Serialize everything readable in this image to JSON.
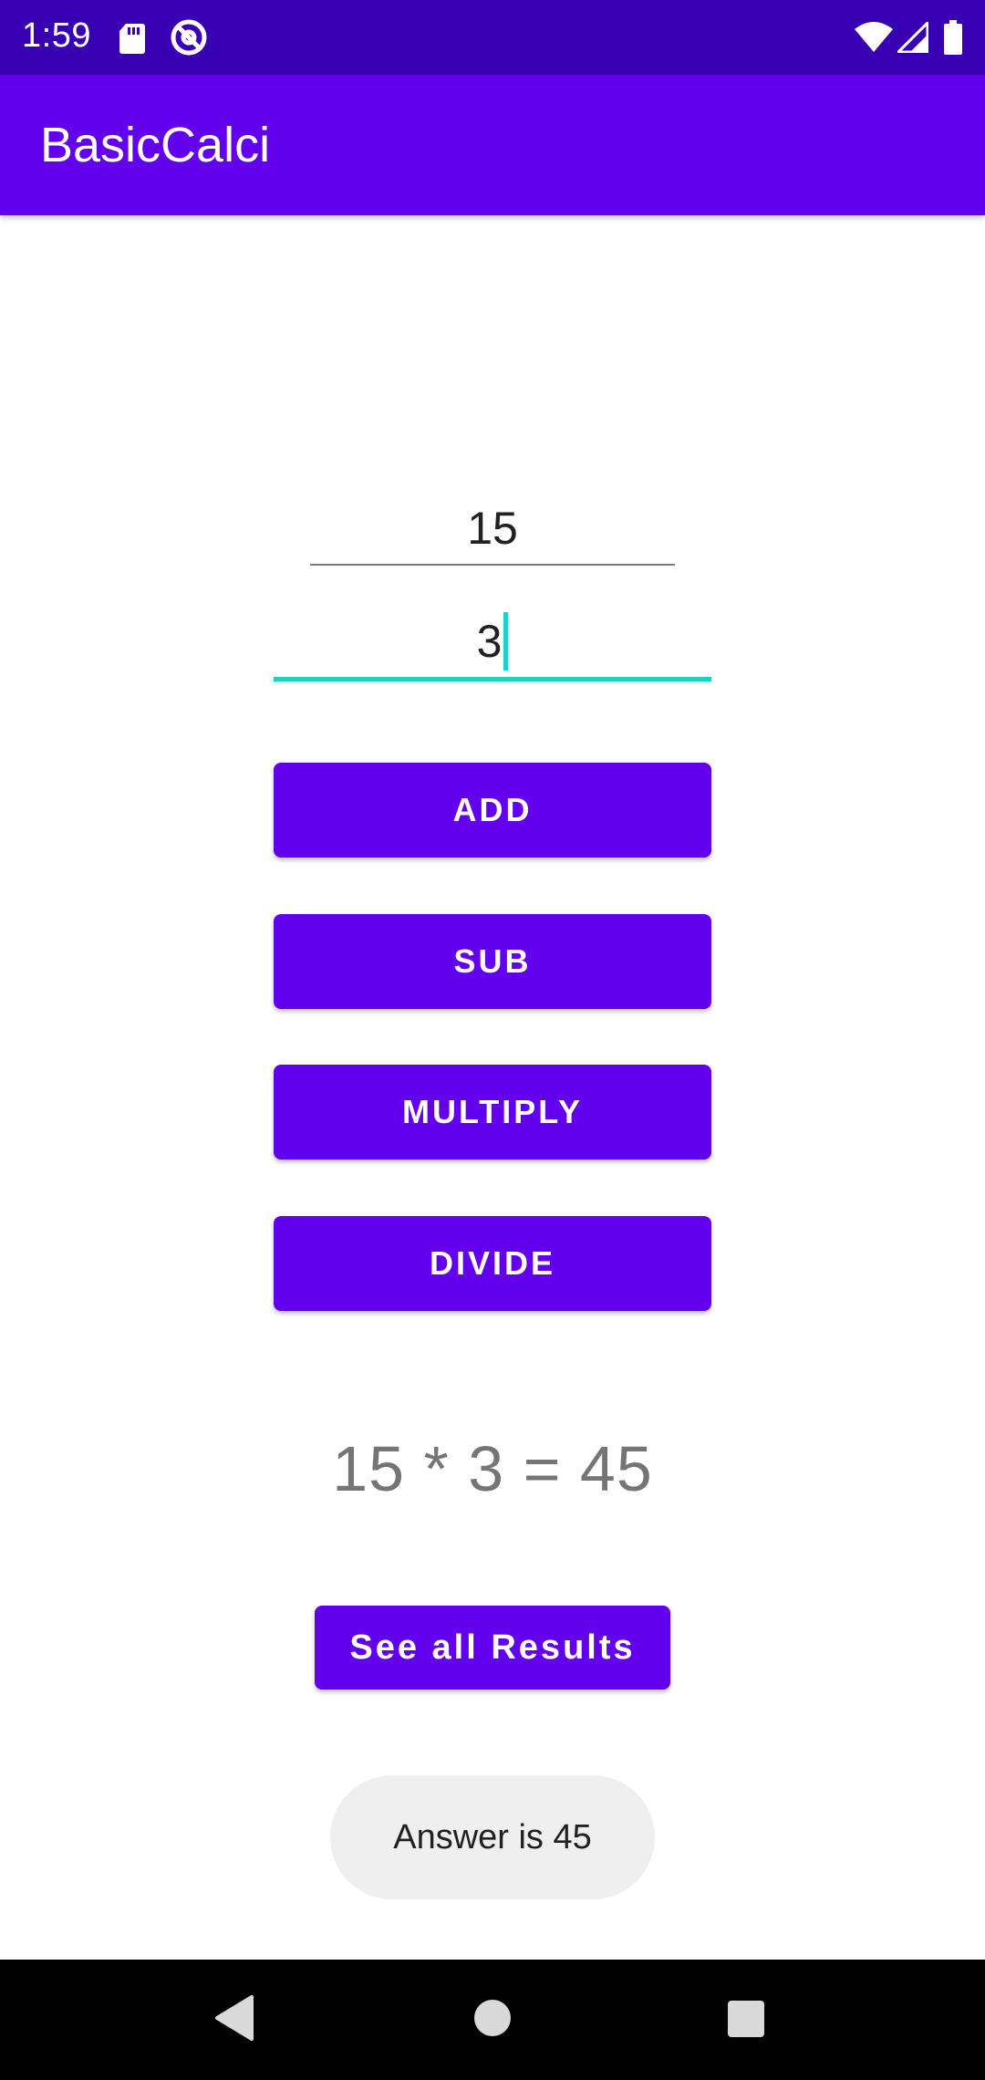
{
  "status_bar": {
    "time": "1:59",
    "icons": [
      "sd-card-icon",
      "at-sign-icon",
      "wifi-icon",
      "cell-signal-icon",
      "battery-icon"
    ]
  },
  "app_bar": {
    "title": "BasicCalci"
  },
  "inputs": {
    "first_number": "15",
    "second_number": "3"
  },
  "buttons": {
    "add": "ADD",
    "sub": "SUB",
    "multiply": "MULTIPLY",
    "divide": "DIVIDE",
    "see_all": "See all Results"
  },
  "result": {
    "text": "15 * 3 = 45"
  },
  "toast": {
    "text": "Answer is 45"
  },
  "nav_bar": {
    "icons": [
      "back-icon",
      "home-icon",
      "recents-icon"
    ]
  },
  "colors": {
    "status_bar": "#3700b3",
    "app_bar": "#6200ee",
    "button": "#6200ee",
    "focus_underline": "#18d3c6",
    "toast_bg": "#efefef"
  }
}
